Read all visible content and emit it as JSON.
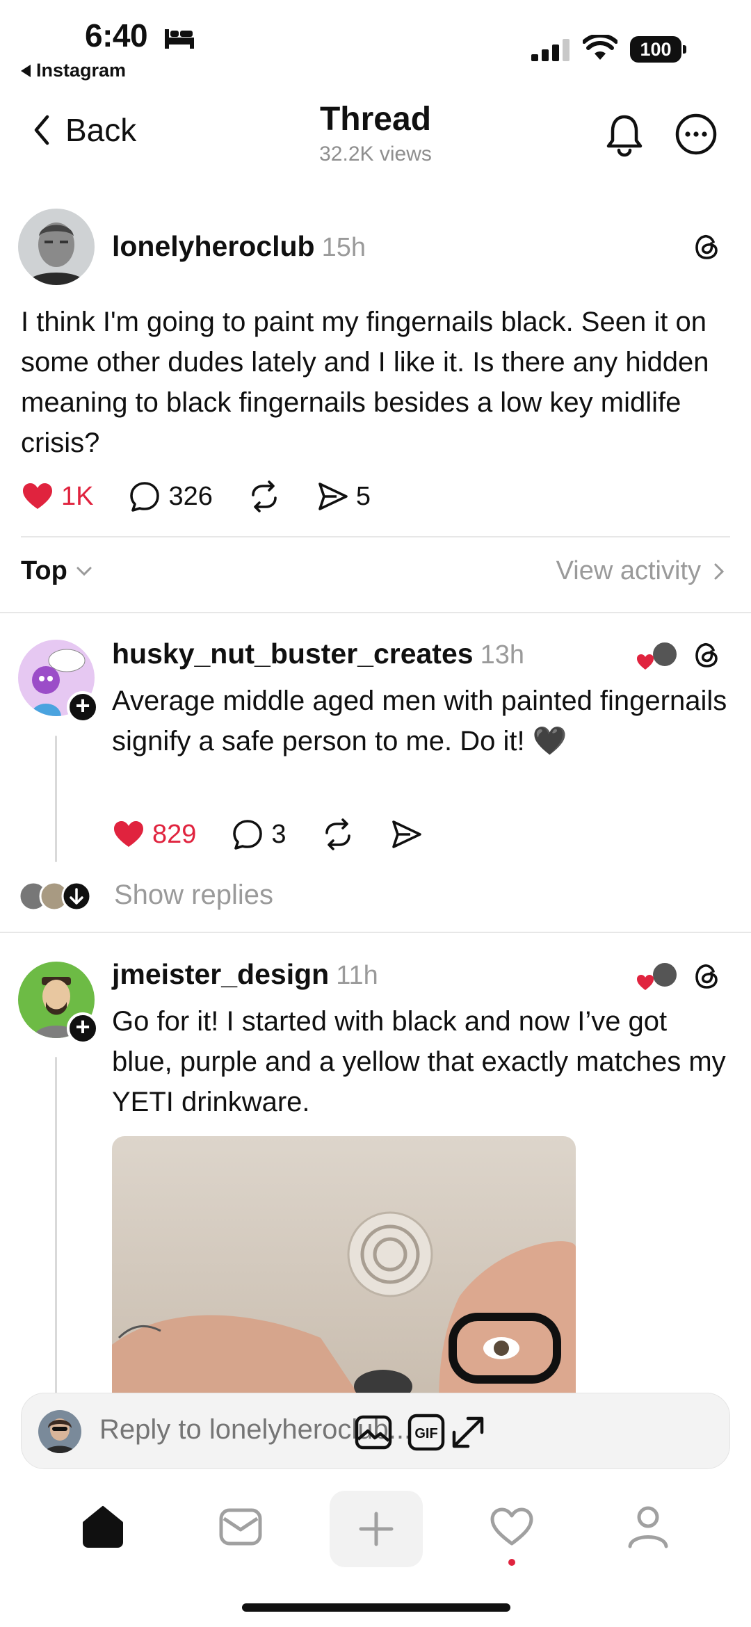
{
  "status_bar": {
    "time": "6:40",
    "back_app": "Instagram",
    "battery": "100"
  },
  "header": {
    "back_label": "Back",
    "title": "Thread",
    "views": "32.2K views"
  },
  "post": {
    "username": "lonelyheroclub",
    "time": "15h",
    "text": "I think I'm going to paint my fingernails black. Seen it on some other dudes lately and I like it. Is there any hidden meaning to black fingernails besides a low key midlife crisis?",
    "likes": "1K",
    "replies": "326",
    "shares": "5"
  },
  "sort": {
    "label": "Top",
    "view_activity": "View activity"
  },
  "replies": [
    {
      "username": "husky_nut_buster_creates",
      "time": "13h",
      "text": "Average middle aged men with painted fingernails signify a safe person to me. Do it! 🖤",
      "likes": "829",
      "replies": "3",
      "show_replies": "Show replies"
    },
    {
      "username": "jmeister_design",
      "time": "11h",
      "text": "Go for it! I started with black and now I’ve got blue, purple and a yellow that exactly matches my YETI drinkware."
    }
  ],
  "composer": {
    "placeholder": "Reply to lonelyheroclub..."
  },
  "colors": {
    "like_red": "#e0233e",
    "muted_gray": "#9a9a9a",
    "text": "#101010"
  },
  "icons": {
    "back": "chevron-left-icon",
    "notifications": "bell-icon",
    "more": "ellipsis-circle-icon",
    "like": "heart-icon",
    "reply": "speech-bubble-icon",
    "repost": "repost-icon",
    "share": "send-icon",
    "threads": "threads-logo-icon",
    "gallery": "image-icon",
    "gif": "gif-icon",
    "expand": "expand-icon",
    "home": "home-icon",
    "inbox": "inbox-icon",
    "create": "plus-icon",
    "activity": "heart-outline-icon",
    "profile": "profile-icon"
  }
}
